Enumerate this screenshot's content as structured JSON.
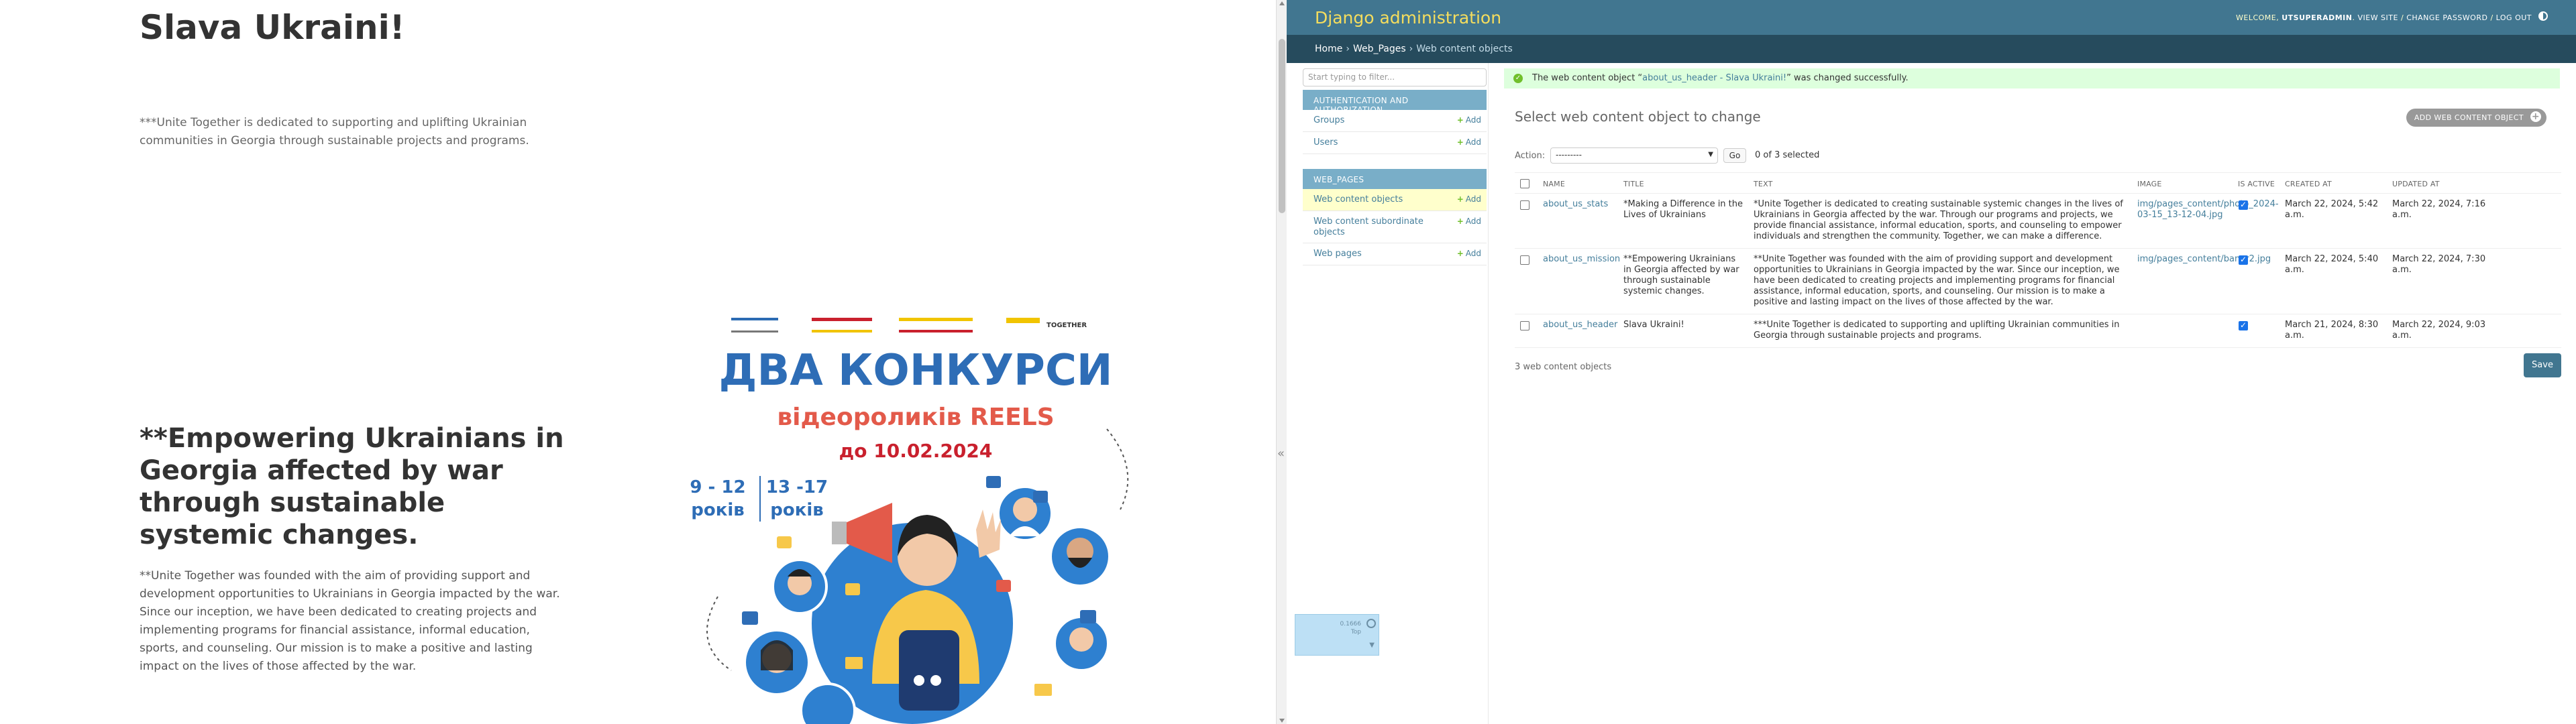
{
  "site": {
    "h1": "Slava Ukraini!",
    "p1": "***Unite Together is dedicated to supporting and uplifting Ukrainian communities in Georgia through sustainable projects and programs.",
    "h2": "**Empowering Ukrainians in Georgia affected by war through sustainable systemic changes.",
    "p2": "**Unite Together was founded with the aim of providing support and development opportunities to Ukrainians in Georgia impacted by the war. Since our inception, we have been dedicated to creating projects and implementing programs for financial assistance, informal education, sports, and counseling. Our mission is to make a positive and lasting impact on the lives of those affected by the war."
  },
  "poster": {
    "logo_text": "TOGETHER",
    "title": "ДВА КОНКУРСИ",
    "subtitle": "відеороликів REELS",
    "deadline": "до 10.02.2024",
    "age1_range": "9 - 12",
    "age1_unit": "років",
    "age2_range": "13 -17",
    "age2_unit": "років"
  },
  "admin": {
    "brand": "Django administration",
    "welcome": "WELCOME,",
    "username": "UTSUPERADMIN",
    "links": [
      "VIEW SITE",
      "CHANGE PASSWORD",
      "LOG OUT"
    ],
    "breadcrumbs": [
      "Home",
      "Web_Pages",
      "Web content objects"
    ],
    "nav_filter_placeholder": "Start typing to filter...",
    "apps": [
      {
        "caption": "AUTHENTICATION AND AUTHORIZATION",
        "models": [
          {
            "name": "Groups",
            "add": "Add"
          },
          {
            "name": "Users",
            "add": "Add"
          }
        ]
      },
      {
        "caption": "WEB_PAGES",
        "models": [
          {
            "name": "Web content objects",
            "add": "Add"
          },
          {
            "name": "Web content subordinate objects",
            "add": "Add"
          },
          {
            "name": "Web pages",
            "add": "Add"
          }
        ]
      }
    ],
    "message": {
      "prefix": "The web content object “",
      "object": "about_us_header - Slava Ukraini!",
      "suffix": "” was changed successfully."
    },
    "title": "Select web content object to change",
    "add_button": "ADD WEB CONTENT OBJECT",
    "action_label": "Action:",
    "action_selected": "---------",
    "go": "Go",
    "selected_counter": "0 of 3 selected",
    "columns": [
      "NAME",
      "TITLE",
      "TEXT",
      "IMAGE",
      "IS ACTIVE",
      "CREATED AT",
      "UPDATED AT"
    ],
    "rows": [
      {
        "name": "about_us_stats",
        "title": "*Making a Difference in the Lives of Ukrainians",
        "text": "*Unite Together is dedicated to creating sustainable systemic changes in the lives of Ukrainians in Georgia affected by the war. Through our programs and projects, we provide financial assistance, informal education, sports, and counseling to empower individuals and strengthen the community. Together, we can make a difference.",
        "image": "img/pages_content/photo_2024-03-15_13-12-04.jpg",
        "is_active": true,
        "created_at": "March 22, 2024, 5:42 a.m.",
        "updated_at": "March 22, 2024, 7:16 a.m."
      },
      {
        "name": "about_us_mission",
        "title": "**Empowering Ukrainians in Georgia affected by war through sustainable systemic changes.",
        "text": "**Unite Together was founded with the aim of providing support and development opportunities to Ukrainians in Georgia impacted by the war. Since our inception, we have been dedicated to creating projects and implementing programs for financial assistance, informal education, sports, and counseling. Our mission is to make a positive and lasting impact on the lives of those affected by the war.",
        "image": "img/pages_content/baner2.jpg",
        "is_active": true,
        "created_at": "March 22, 2024, 5:40 a.m.",
        "updated_at": "March 22, 2024, 7:30 a.m."
      },
      {
        "name": "about_us_header",
        "title": "Slava Ukraini!",
        "text": "***Unite Together is dedicated to supporting and uplifting Ukrainian communities in Georgia through sustainable projects and programs.",
        "image": "",
        "is_active": true,
        "created_at": "March 21, 2024, 8:30 a.m.",
        "updated_at": "March 22, 2024, 9:03 a.m."
      }
    ],
    "result_count": "3 web content objects",
    "save": "Save"
  },
  "widget": {
    "line1": "0.1666",
    "line2": "Top"
  },
  "colors": {
    "admin_header": "#417690",
    "breadcrumbs": "#264b5d",
    "brand_yellow": "#f5dd5d",
    "link": "#447e9b",
    "message_bg": "#dfd",
    "poster_blue": "#2e6db6",
    "poster_red": "#e35a4a"
  }
}
